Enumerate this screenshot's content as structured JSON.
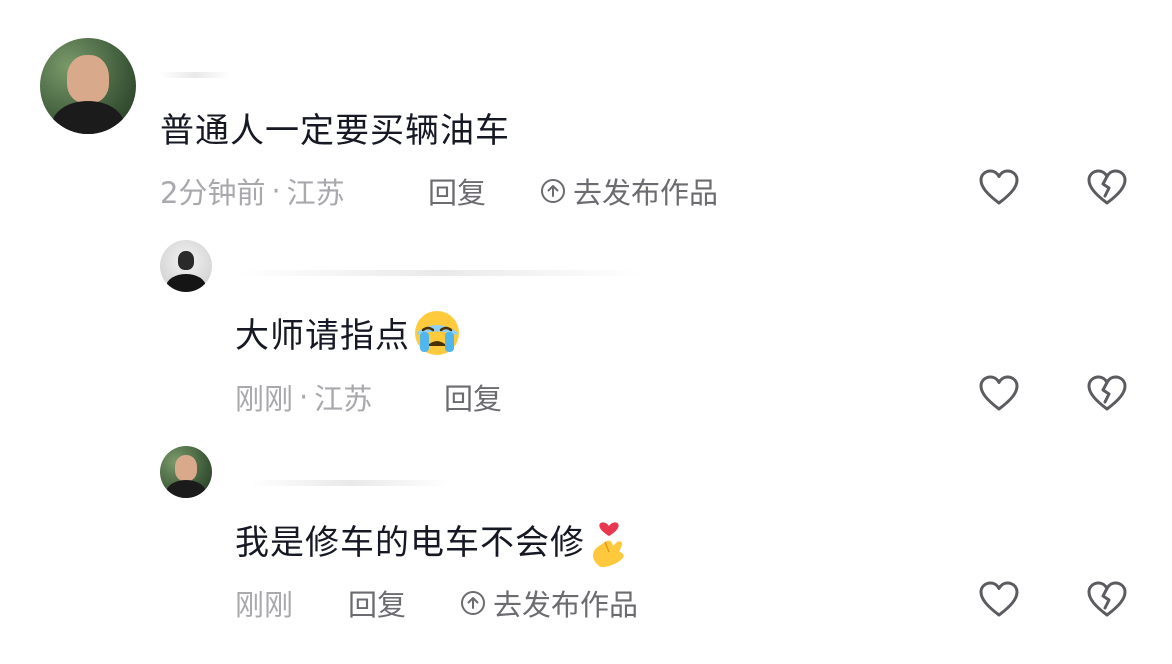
{
  "comments": [
    {
      "text": "普通人一定要买辆油车",
      "time": "2分钟前",
      "location": "江苏",
      "reply_label": "回复",
      "publish_label": "去发布作品"
    },
    {
      "text": "大师请指点",
      "emoji": "loudly-crying-face",
      "time": "刚刚",
      "location": "江苏",
      "reply_label": "回复"
    },
    {
      "text": "我是修车的电车不会修",
      "emoji": "finger-heart",
      "time": "刚刚",
      "reply_label": "回复",
      "publish_label": "去发布作品"
    }
  ],
  "separator": "·",
  "icons": {
    "like": "heart-outline-icon",
    "dislike": "broken-heart-outline-icon",
    "publish": "arrow-up-circle-icon"
  },
  "colors": {
    "text": "#161823",
    "meta": "#a8a8ad",
    "action": "#6b6b70",
    "icon": "#5c5c60"
  }
}
